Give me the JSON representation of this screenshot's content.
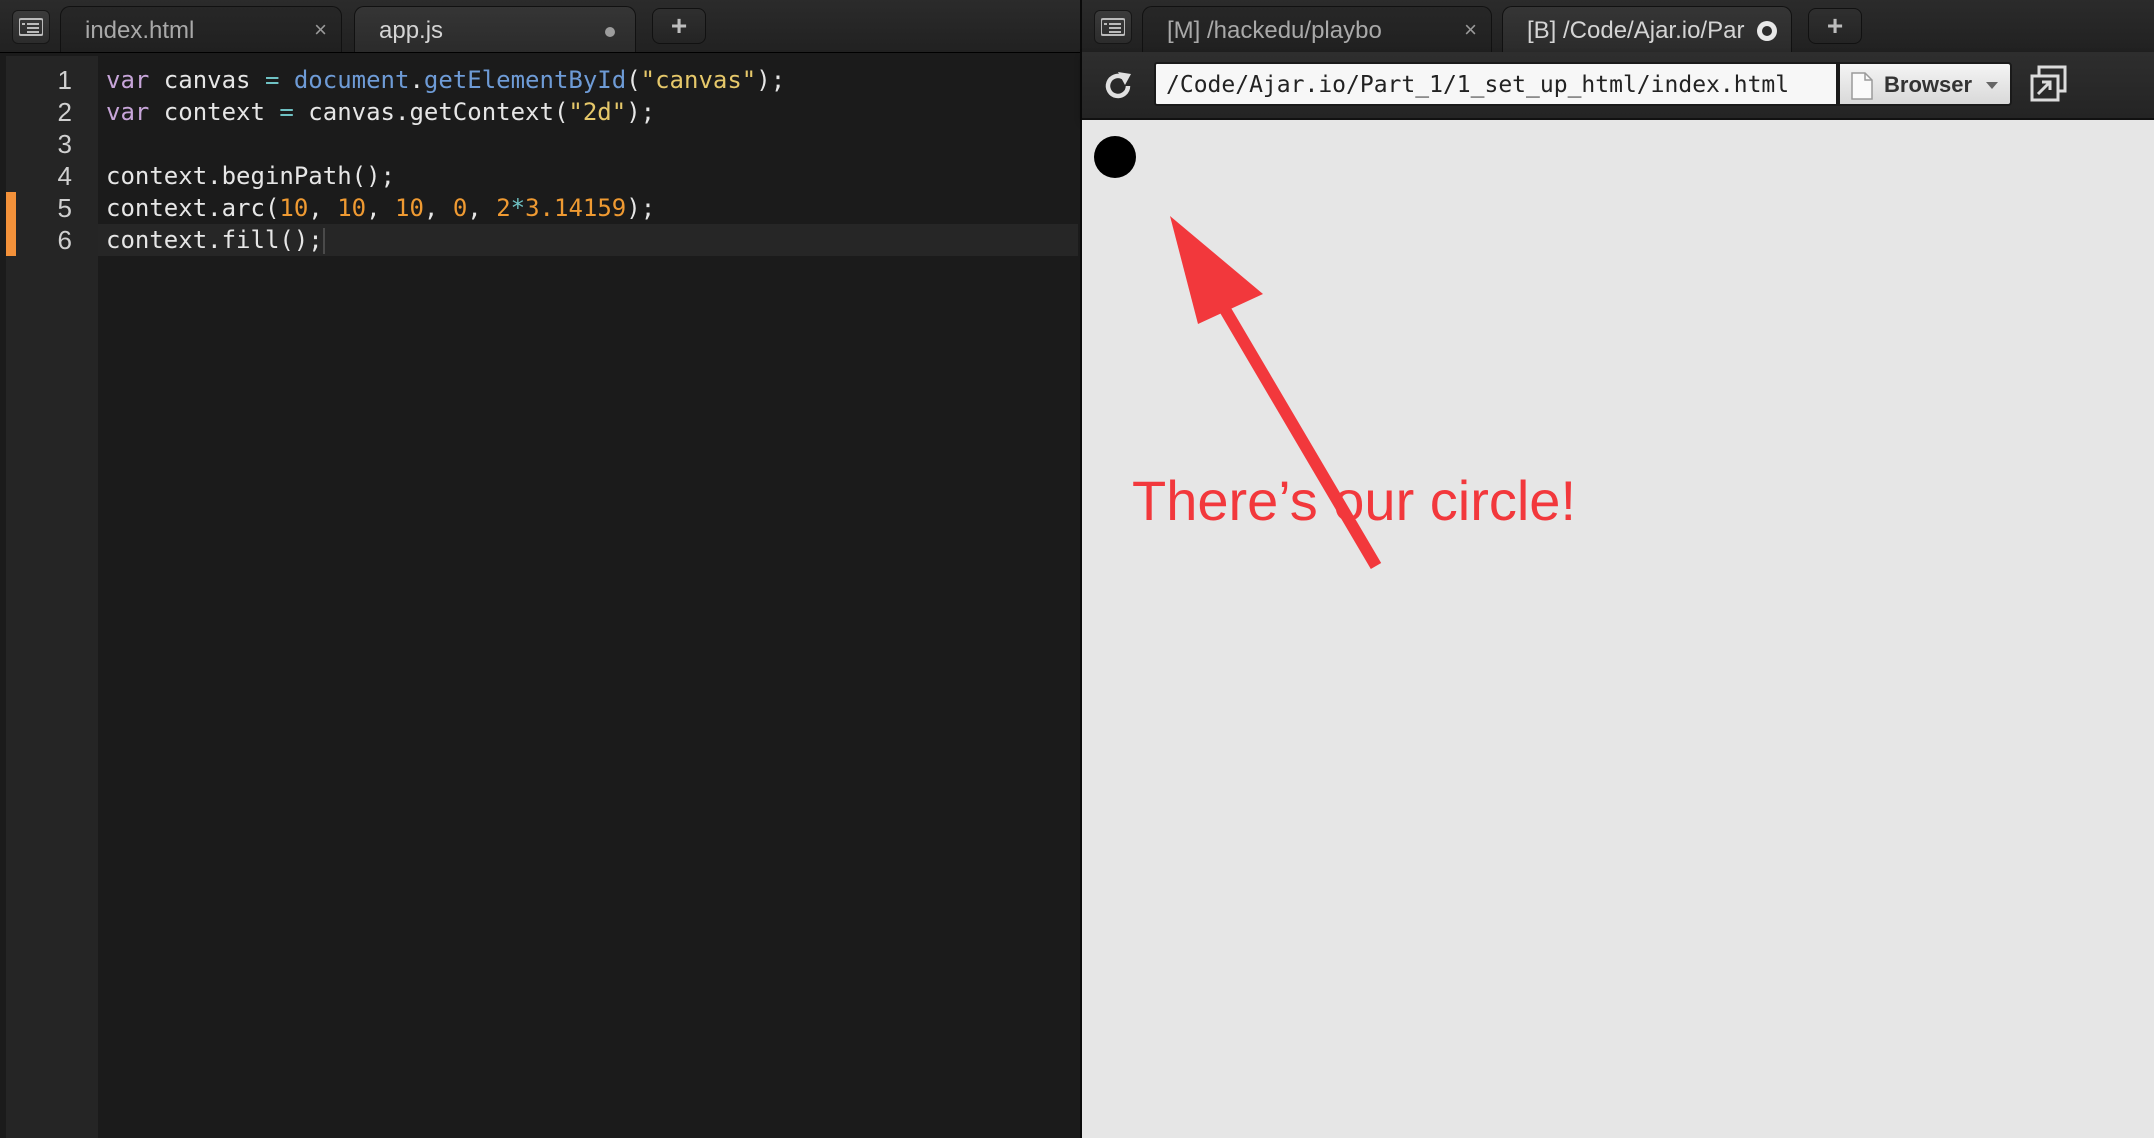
{
  "left_pane": {
    "tabs": [
      {
        "label": "index.html",
        "state": "inactive",
        "indicator": "×"
      },
      {
        "label": "app.js",
        "state": "active",
        "indicator": "unsaved-dot"
      }
    ],
    "new_tab_label": "+",
    "code": {
      "lines": [
        {
          "num": "1",
          "tokens": [
            {
              "t": "var",
              "k": "kw"
            },
            {
              "t": " canvas ",
              "k": "plain"
            },
            {
              "t": "=",
              "k": "op"
            },
            {
              "t": " ",
              "k": "plain"
            },
            {
              "t": "document",
              "k": "obj"
            },
            {
              "t": ".",
              "k": "plain"
            },
            {
              "t": "getElementById",
              "k": "obj"
            },
            {
              "t": "(",
              "k": "plain"
            },
            {
              "t": "\"canvas\"",
              "k": "str"
            },
            {
              "t": ");",
              "k": "plain"
            }
          ]
        },
        {
          "num": "2",
          "tokens": [
            {
              "t": "var",
              "k": "kw"
            },
            {
              "t": " context ",
              "k": "plain"
            },
            {
              "t": "=",
              "k": "op"
            },
            {
              "t": " canvas.getContext(",
              "k": "plain"
            },
            {
              "t": "\"2d\"",
              "k": "str"
            },
            {
              "t": ");",
              "k": "plain"
            }
          ]
        },
        {
          "num": "3",
          "tokens": []
        },
        {
          "num": "4",
          "tokens": [
            {
              "t": "context.beginPath();",
              "k": "plain"
            }
          ]
        },
        {
          "num": "5",
          "tokens": [
            {
              "t": "context.arc(",
              "k": "plain"
            },
            {
              "t": "10",
              "k": "num"
            },
            {
              "t": ", ",
              "k": "plain"
            },
            {
              "t": "10",
              "k": "num"
            },
            {
              "t": ", ",
              "k": "plain"
            },
            {
              "t": "10",
              "k": "num"
            },
            {
              "t": ", ",
              "k": "plain"
            },
            {
              "t": "0",
              "k": "num"
            },
            {
              "t": ", ",
              "k": "plain"
            },
            {
              "t": "2",
              "k": "num"
            },
            {
              "t": "*",
              "k": "op"
            },
            {
              "t": "3.14159",
              "k": "num"
            },
            {
              "t": ");",
              "k": "plain"
            }
          ]
        },
        {
          "num": "6",
          "tokens": [
            {
              "t": "context.fill();",
              "k": "plain"
            }
          ]
        }
      ],
      "modified_lines": [
        "5",
        "6"
      ],
      "current_line": "6"
    }
  },
  "right_pane": {
    "tabs": [
      {
        "label": "[M] /hackedu/playbo",
        "state": "inactive",
        "indicator": "×"
      },
      {
        "label": "[B] /Code/Ajar.io/Par",
        "state": "active",
        "indicator": "loading-ring"
      }
    ],
    "new_tab_label": "+",
    "url": "/Code/Ajar.io/Part_1/1_set_up_html/index.html",
    "mode_label": "Browser",
    "annotation": "There’s our circle!"
  },
  "colors": {
    "annotation": "#f2383c",
    "modified_marker": "#f3913a",
    "keyword": "#c7a5d9",
    "string": "#e6c86a",
    "number": "#ef9a32"
  }
}
